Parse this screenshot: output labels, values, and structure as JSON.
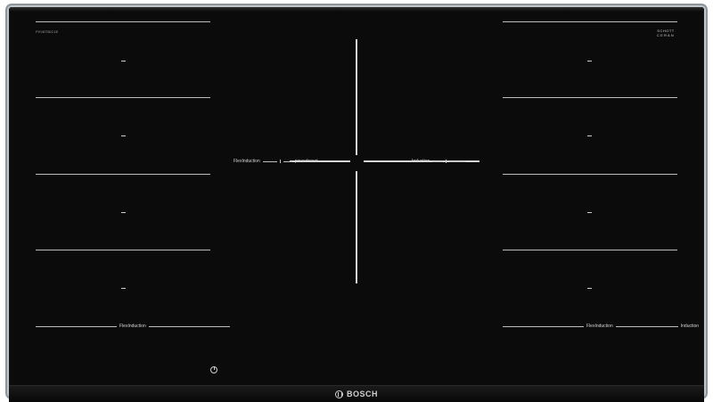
{
  "model_code": "PXV875DC1E",
  "logo": {
    "line1": "SCHOTT",
    "line2": "CERAN",
    "sub": "®"
  },
  "left_zones": {
    "labels": [
      "–",
      "–",
      "–",
      "–"
    ]
  },
  "right_zones": {
    "labels": [
      "–",
      "–",
      "–",
      "–"
    ]
  },
  "left_bottom": {
    "label": "FlexInduction"
  },
  "right_bottom": {
    "label_a": "FlexInduction",
    "label_b": "Induction"
  },
  "center": {
    "left_label_a": "FlexInduction",
    "left_label_b": "powerboost",
    "right_label": "Induction"
  },
  "brand": {
    "name": "BOSCH",
    "icon": "bosch-logo-icon"
  },
  "power": {
    "icon": "power-icon"
  },
  "colors": {
    "glass": "#0b0b0b",
    "lines": "#bdbdbd",
    "frame": "#bfc5c9"
  }
}
